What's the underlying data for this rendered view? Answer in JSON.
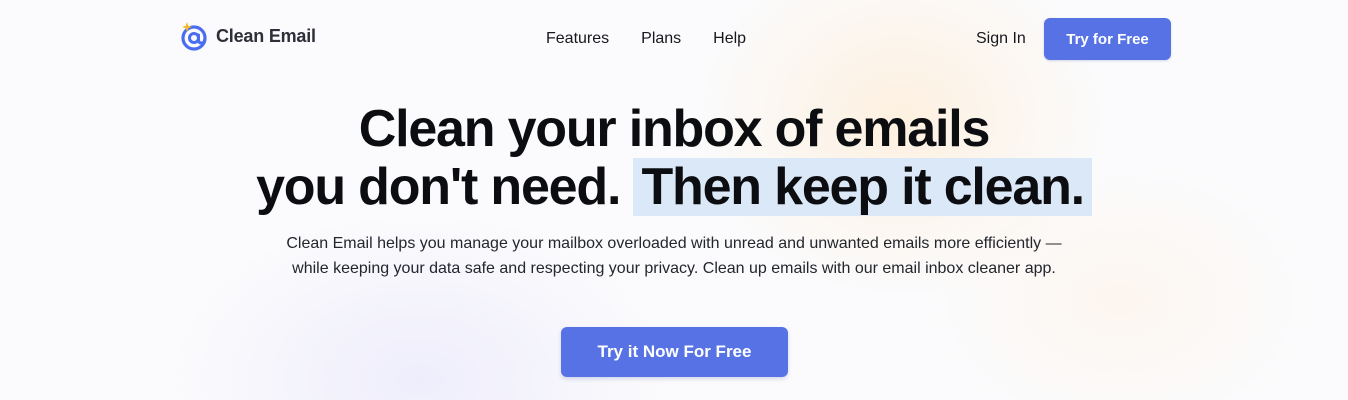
{
  "header": {
    "logo_text": "Clean Email",
    "logo_icon": "at-sign-sparkle-icon",
    "nav": [
      {
        "label": "Features"
      },
      {
        "label": "Plans"
      },
      {
        "label": "Help"
      }
    ],
    "sign_in_label": "Sign In",
    "try_free_label": "Try for Free"
  },
  "hero": {
    "title_line1": "Clean your inbox of emails",
    "title_line2_plain": "you don't need.",
    "title_line2_highlight": "Then keep it clean.",
    "subtitle": "Clean Email helps you manage your mailbox overloaded with unread and unwanted emails more efficiently — while keeping your data safe and respecting your privacy. Clean up emails with our email inbox cleaner app.",
    "cta_label": "Try it Now For Free"
  },
  "colors": {
    "accent": "#5672e5",
    "highlight_bg": "#dbe8f7",
    "logo_blue": "#4a6cf0",
    "logo_gold": "#f5b82e"
  }
}
